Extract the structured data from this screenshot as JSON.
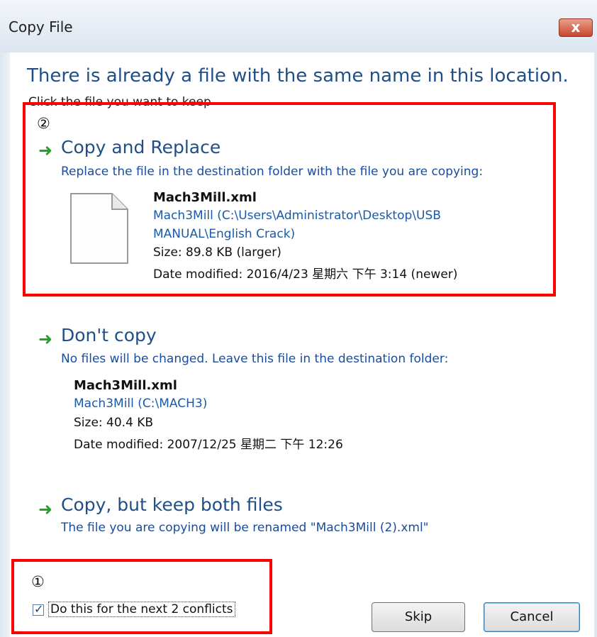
{
  "window": {
    "title": "Copy File",
    "close_glyph": "x"
  },
  "heading": "There is already a file with the same name in this location.",
  "subtext": "Click the file you want to keep",
  "markers": {
    "top": "②",
    "bottom": "①"
  },
  "options": {
    "replace": {
      "title": "Copy and Replace",
      "desc": "Replace the file in the destination folder with the file you are copying:",
      "file_name": "Mach3Mill.xml",
      "path_line1": "Mach3Mill (C:\\Users\\Administrator\\Desktop\\USB",
      "path_line2": "MANUAL\\English Crack)",
      "size": "Size: 89.8 KB (larger)",
      "modified": "Date modified: 2016/4/23 星期六 下午 3:14 (newer)"
    },
    "dont_copy": {
      "title": "Don't copy",
      "desc": "No files will be changed. Leave this file in the destination folder:",
      "file_name": "Mach3Mill.xml",
      "path": "Mach3Mill (C:\\MACH3)",
      "size": "Size: 40.4 KB",
      "modified": "Date modified: 2007/12/25 星期二 下午 12:26"
    },
    "keep_both": {
      "title": "Copy, but keep both files",
      "desc": "The file you are copying will be renamed \"Mach3Mill (2).xml\""
    }
  },
  "footer": {
    "checkbox_label": "Do this for the next 2 conflicts",
    "checkbox_checked": true,
    "skip_label": "Skip",
    "cancel_label": "Cancel"
  },
  "icons": {
    "arrow": "green-arrow-icon",
    "file": "file-icon"
  },
  "colors": {
    "heading": "#1f4f86",
    "link": "#1a4c9c",
    "arrow": "#28a028",
    "highlight_box": "#ff0000"
  }
}
